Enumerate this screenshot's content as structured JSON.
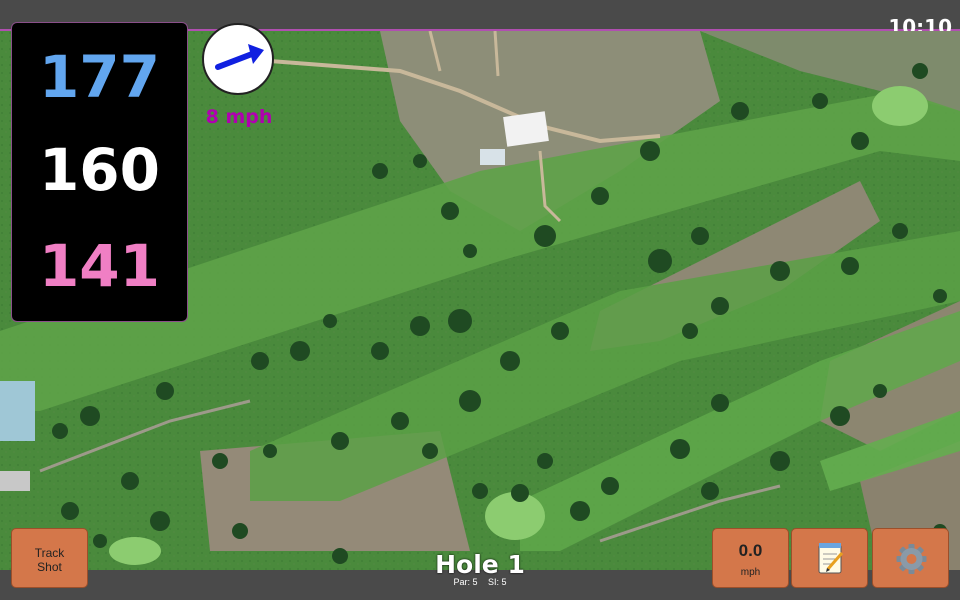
{
  "status_bar": {
    "time": "10:10"
  },
  "distances": {
    "back": "177",
    "middle": "160",
    "front": "141"
  },
  "wind": {
    "speed_label": "8 mph",
    "direction_icon": "arrow-east-northeast",
    "button_value": "0.0",
    "button_unit": "mph"
  },
  "buttons": {
    "track_line1": "Track",
    "track_line2": "Shot",
    "notes_icon": "notepad-icon",
    "settings_icon": "gear-icon"
  },
  "hole": {
    "title": "Hole 1",
    "par": "Par: 5",
    "si": "SI: 5"
  },
  "colors": {
    "back": "#62a6ef",
    "middle": "#ffffff",
    "front": "#f07fc4",
    "button": "#d4774a",
    "accent": "#b000b0"
  }
}
